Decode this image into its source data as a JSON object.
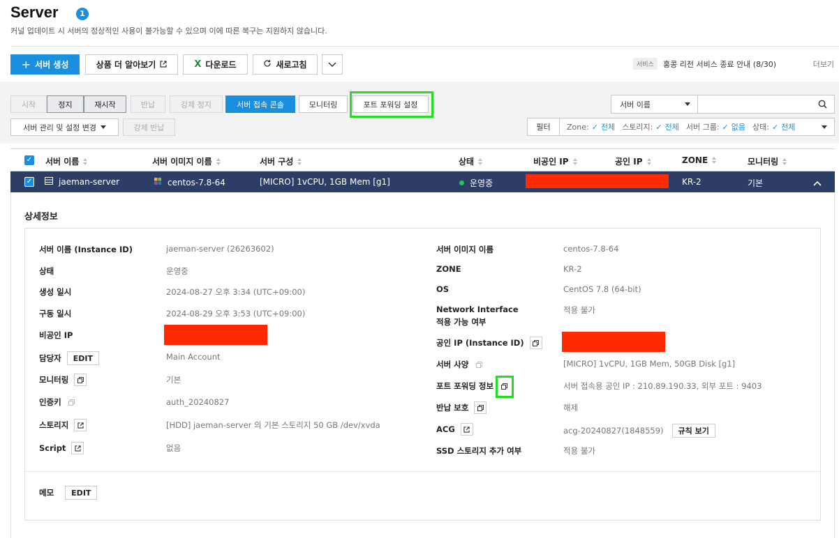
{
  "header": {
    "title": "Server",
    "badge": "1",
    "subtitle": "커널 업데이트 시 서버의 정상적인 사용이 불가능할 수 있으며 이에 따른 복구는 지원하지 않습니다."
  },
  "toolbar": {
    "create_label": "서버 생성",
    "learn_more_label": "상품 더 알아보기",
    "download_label": "다운로드",
    "refresh_label": "새로고침",
    "notice_tag": "서비스",
    "notice_text": "홍콩 리전 서비스 종료 안내 (8/30)",
    "more_label": "더보기"
  },
  "actions": {
    "start": "시작",
    "stop": "정지",
    "restart": "재시작",
    "return": "반납",
    "force_stop": "강제 정지",
    "console": "서버 접속 콘솔",
    "monitoring": "모니터링",
    "port_forwarding": "포트 포워딩 설정",
    "manage": "서버 관리 및 설정 변경",
    "force_return": "강제 반납"
  },
  "search": {
    "select_value": "서버 이름"
  },
  "filter": {
    "button": "필터",
    "zone_label": "Zone:",
    "zone_value": "전체",
    "storage_label": "스토리지:",
    "storage_value": "전체",
    "group_label": "서버 그룹:",
    "group_value": "없음",
    "status_label": "상태:",
    "status_value": "전체"
  },
  "table": {
    "columns": [
      "서버 이름",
      "서버 이미지 이름",
      "서버 구성",
      "상태",
      "비공인 IP",
      "공인 IP",
      "ZONE",
      "모니터링"
    ],
    "row": {
      "name": "jaeman-server",
      "image": "centos-7.8-64",
      "spec": "[MICRO] 1vCPU, 1GB Mem [g1]",
      "status": "운영중",
      "zone": "KR-2",
      "monitoring": "기본"
    }
  },
  "detail": {
    "title": "상세정보",
    "left": [
      {
        "label": "서버 이름 (Instance ID)",
        "value": "jaeman-server (26263602)"
      },
      {
        "label": "상태",
        "value": "운영중"
      },
      {
        "label": "생성 일시",
        "value": "2024-08-27 오후 3:34 (UTC+09:00)"
      },
      {
        "label": "구동 일시",
        "value": "2024-08-29 오후 3:53 (UTC+09:00)"
      },
      {
        "label": "비공인 IP",
        "value": ""
      },
      {
        "label": "담당자",
        "value": "Main Account",
        "button": "EDIT"
      },
      {
        "label": "모니터링",
        "value": "기본"
      },
      {
        "label": "인증키",
        "value": "auth_20240827"
      },
      {
        "label": "스토리지",
        "value": "[HDD] jaeman-server 의 기본 스토리지  50 GB /dev/xvda"
      },
      {
        "label": "Script",
        "value": "없음"
      }
    ],
    "right": [
      {
        "label": "서버 이미지 이름",
        "value": "centos-7.8-64"
      },
      {
        "label": "ZONE",
        "value": "KR-2"
      },
      {
        "label": "OS",
        "value": "CentOS 7.8 (64-bit)"
      },
      {
        "label": "Network Interface",
        "label2": "적용 가능 여부",
        "value": "적용 불가"
      },
      {
        "label": "공인 IP (Instance ID)",
        "value": ""
      },
      {
        "label": "서버 사양",
        "value": "[MICRO] 1vCPU, 1GB Mem, 50GB Disk [g1]"
      },
      {
        "label": "포트 포워딩 정보",
        "value": "서버 접속용 공인 IP : 210.89.190.33, 외부 포트 : 9403"
      },
      {
        "label": "반납 보호",
        "value": "해제"
      },
      {
        "label": "ACG",
        "value": "acg-20240827(1848559)",
        "button": "규칙 보기"
      },
      {
        "label": "SSD 스토리지 추가 여부",
        "value": "적용 불가"
      }
    ],
    "memo_label": "메모",
    "memo_button": "EDIT"
  },
  "colors": {
    "primary": "#1a8fe0",
    "selected_row": "#2c3e66",
    "highlight": "#22dd22",
    "redaction": "#ff2a00",
    "running": "#22c55e"
  }
}
